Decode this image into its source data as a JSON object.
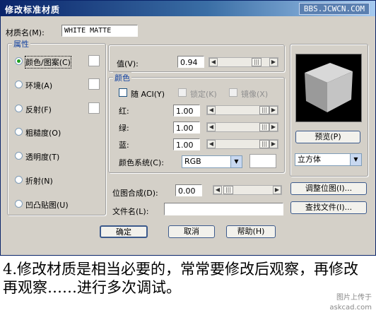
{
  "window": {
    "title": "修改标准材质",
    "watermark": "BBS.JCWCN.COM"
  },
  "material_name": {
    "label": "材质名(M):",
    "value": "WHITE MATTE"
  },
  "attributes": {
    "group_label": "属性",
    "items": [
      {
        "label": "颜色/图案(C)",
        "selected": true
      },
      {
        "label": "环境(A)",
        "selected": false
      },
      {
        "label": "反射(F)",
        "selected": false
      },
      {
        "label": "粗糙度(O)",
        "selected": false
      },
      {
        "label": "透明度(T)",
        "selected": false
      },
      {
        "label": "折射(N)",
        "selected": false
      },
      {
        "label": "凹凸贴图(U)",
        "selected": false
      }
    ]
  },
  "value": {
    "label": "值(V):",
    "value": "0.94"
  },
  "color": {
    "group_label": "颜色",
    "by_aci_label": "随 ACI(Y)",
    "lock_label": "锁定(K)",
    "mirror_label": "镜像(X)",
    "red": {
      "label": "红:",
      "value": "1.00"
    },
    "green": {
      "label": "绿:",
      "value": "1.00"
    },
    "blue": {
      "label": "蓝:",
      "value": "1.00"
    },
    "system_label": "颜色系统(C):",
    "system_value": "RGB"
  },
  "bitmap_blend": {
    "label": "位图合成(D):",
    "value": "0.00"
  },
  "file_name": {
    "label": "文件名(L):",
    "value": ""
  },
  "buttons": {
    "preview": "预览(P)",
    "adjust_bitmap": "调整位图(I)...",
    "find_file": "查找文件(I)...",
    "ok": "确定",
    "cancel": "取消",
    "help": "帮助(H)"
  },
  "preview_shape": "立方体",
  "caption": "4.修改材质是相当必要的，常常要修改后观察，再修改再观察……进行多次调试。",
  "site_watermark": {
    "line1": "图片上传于",
    "line2": "askcad.com"
  },
  "colors": {
    "title_bar": "#0a246a",
    "dialog_bg": "#d4d0c8",
    "group_title": "#1040a0"
  }
}
